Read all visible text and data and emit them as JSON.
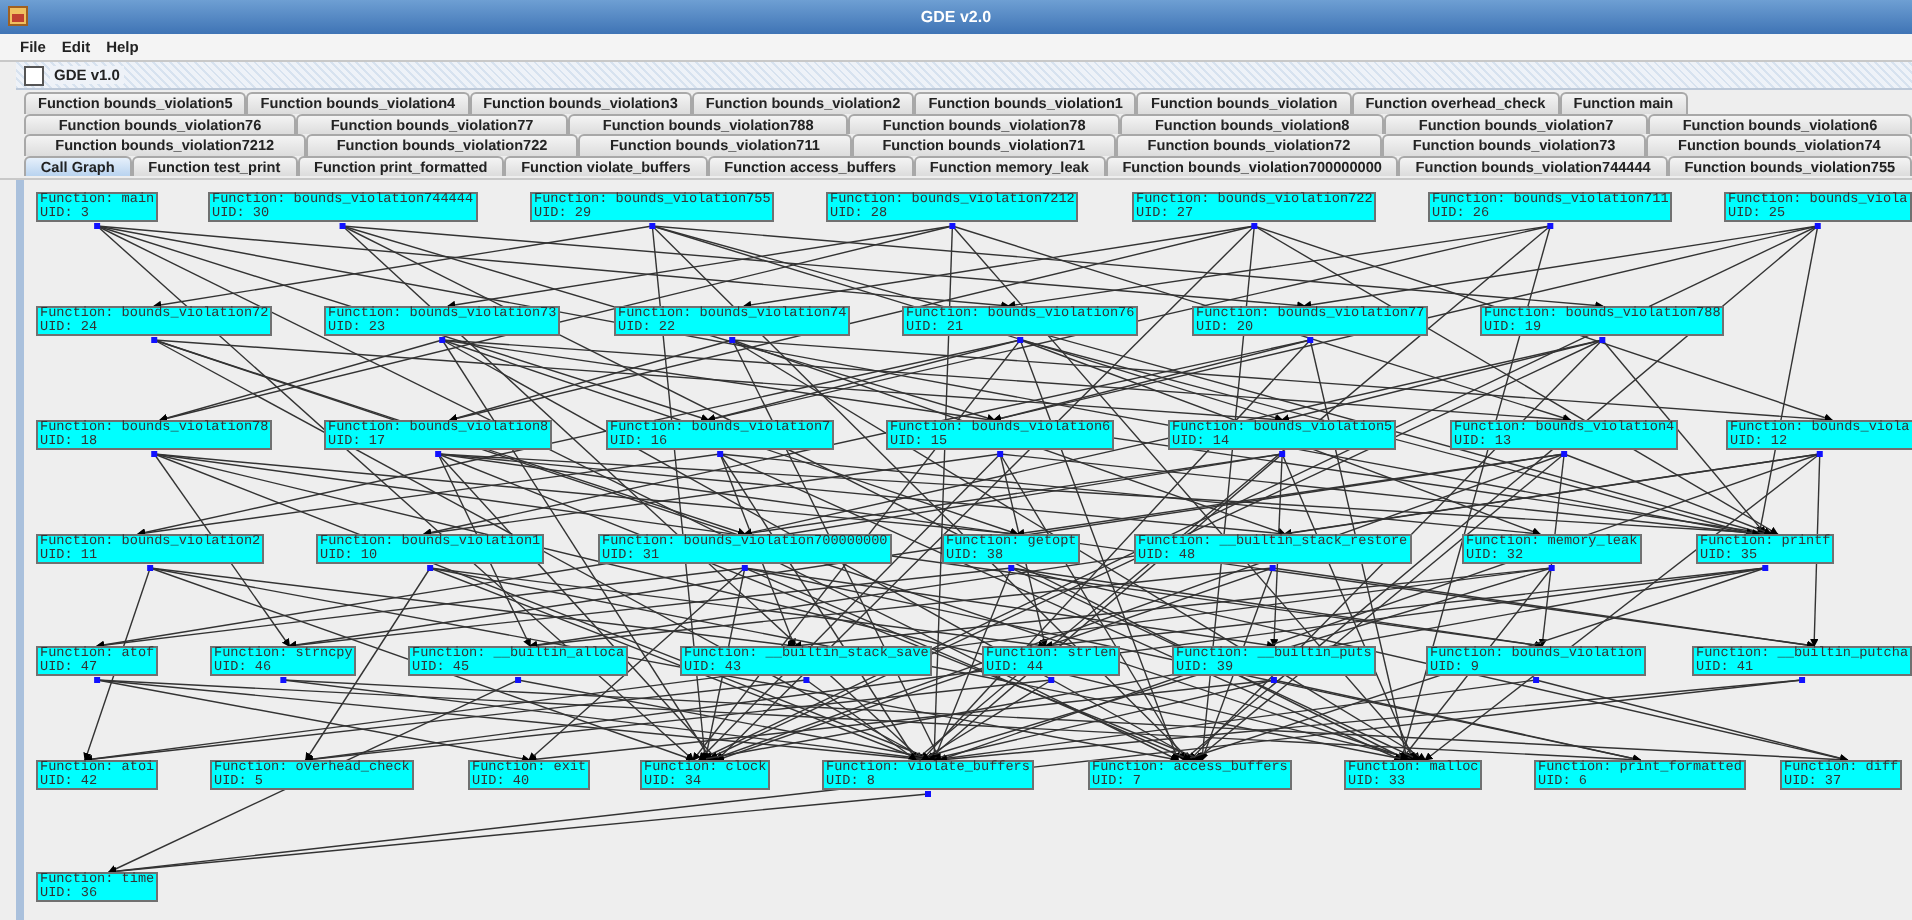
{
  "window": {
    "title": "GDE v2.0"
  },
  "menu": [
    "File",
    "Edit",
    "Help"
  ],
  "inner_frame": {
    "title": "GDE v1.0"
  },
  "tab_rows": [
    [
      {
        "label": "Function bounds_violation5",
        "selected": false
      },
      {
        "label": "Function bounds_violation4",
        "selected": false
      },
      {
        "label": "Function bounds_violation3",
        "selected": false
      },
      {
        "label": "Function bounds_violation2",
        "selected": false
      },
      {
        "label": "Function bounds_violation1",
        "selected": false
      },
      {
        "label": "Function bounds_violation",
        "selected": false
      },
      {
        "label": "Function overhead_check",
        "selected": false
      },
      {
        "label": "Function main",
        "selected": false
      }
    ],
    [
      {
        "label": "Function bounds_violation76",
        "selected": false
      },
      {
        "label": "Function bounds_violation77",
        "selected": false
      },
      {
        "label": "Function bounds_violation788",
        "selected": false
      },
      {
        "label": "Function bounds_violation78",
        "selected": false
      },
      {
        "label": "Function bounds_violation8",
        "selected": false
      },
      {
        "label": "Function bounds_violation7",
        "selected": false
      },
      {
        "label": "Function bounds_violation6",
        "selected": false
      }
    ],
    [
      {
        "label": "Function bounds_violation7212",
        "selected": false
      },
      {
        "label": "Function bounds_violation722",
        "selected": false
      },
      {
        "label": "Function bounds_violation711",
        "selected": false
      },
      {
        "label": "Function bounds_violation71",
        "selected": false
      },
      {
        "label": "Function bounds_violation72",
        "selected": false
      },
      {
        "label": "Function bounds_violation73",
        "selected": false
      },
      {
        "label": "Function bounds_violation74",
        "selected": false
      }
    ],
    [
      {
        "label": "Call Graph",
        "selected": true
      },
      {
        "label": "Function test_print",
        "selected": false
      },
      {
        "label": "Function print_formatted",
        "selected": false
      },
      {
        "label": "Function violate_buffers",
        "selected": false
      },
      {
        "label": "Function access_buffers",
        "selected": false
      },
      {
        "label": "Function memory_leak",
        "selected": false
      },
      {
        "label": "Function bounds_violation700000000",
        "selected": false
      },
      {
        "label": "Function bounds_violation744444",
        "selected": false
      },
      {
        "label": "Function bounds_violation755",
        "selected": false
      }
    ]
  ],
  "graph": {
    "node_rows": [
      [
        {
          "name": "Function: main",
          "uid": "UID: 3"
        },
        {
          "name": "Function: bounds_violation744444",
          "uid": "UID: 30"
        },
        {
          "name": "Function: bounds_violation755",
          "uid": "UID: 29"
        },
        {
          "name": "Function: bounds_violation7212",
          "uid": "UID: 28"
        },
        {
          "name": "Function: bounds_violation722",
          "uid": "UID: 27"
        },
        {
          "name": "Function: bounds_violation711",
          "uid": "UID: 26"
        },
        {
          "name": "Function: bounds_viola",
          "uid": "UID: 25"
        }
      ],
      [
        {
          "name": "Function: bounds_violation72",
          "uid": "UID: 24"
        },
        {
          "name": "Function: bounds_violation73",
          "uid": "UID: 23"
        },
        {
          "name": "Function: bounds_violation74",
          "uid": "UID: 22"
        },
        {
          "name": "Function: bounds_violation76",
          "uid": "UID: 21"
        },
        {
          "name": "Function: bounds_violation77",
          "uid": "UID: 20"
        },
        {
          "name": "Function: bounds_violation788",
          "uid": "UID: 19"
        }
      ],
      [
        {
          "name": "Function: bounds_violation78",
          "uid": "UID: 18"
        },
        {
          "name": "Function: bounds_violation8",
          "uid": "UID: 17"
        },
        {
          "name": "Function: bounds_violation7",
          "uid": "UID: 16"
        },
        {
          "name": "Function: bounds_violation6",
          "uid": "UID: 15"
        },
        {
          "name": "Function: bounds_violation5",
          "uid": "UID: 14"
        },
        {
          "name": "Function: bounds_violation4",
          "uid": "UID: 13"
        },
        {
          "name": "Function: bounds_viola",
          "uid": "UID: 12"
        }
      ],
      [
        {
          "name": "Function: bounds_violation2",
          "uid": "UID: 11"
        },
        {
          "name": "Function: bounds_violation1",
          "uid": "UID: 10"
        },
        {
          "name": "Function: bounds_violation700000000",
          "uid": "UID: 31"
        },
        {
          "name": "Function: getopt",
          "uid": "UID: 38"
        },
        {
          "name": "Function: __builtin_stack_restore",
          "uid": "UID: 48"
        },
        {
          "name": "Function: memory_leak",
          "uid": "UID: 32"
        },
        {
          "name": "Function: printf",
          "uid": "UID: 35"
        }
      ],
      [
        {
          "name": "Function: atof",
          "uid": "UID: 47"
        },
        {
          "name": "Function: strncpy",
          "uid": "UID: 46"
        },
        {
          "name": "Function: __builtin_alloca",
          "uid": "UID: 45"
        },
        {
          "name": "Function: __builtin_stack_save",
          "uid": "UID: 43"
        },
        {
          "name": "Function: strlen",
          "uid": "UID: 44"
        },
        {
          "name": "Function: __builtin_puts",
          "uid": "UID: 39"
        },
        {
          "name": "Function: bounds_violation",
          "uid": "UID: 9"
        },
        {
          "name": "Function: __builtin_putcha",
          "uid": "UID: 41"
        }
      ],
      [
        {
          "name": "Function: atoi",
          "uid": "UID: 42"
        },
        {
          "name": "Function: overhead_check",
          "uid": "UID: 5"
        },
        {
          "name": "Function: exit",
          "uid": "UID: 40"
        },
        {
          "name": "Function: clock",
          "uid": "UID: 34"
        },
        {
          "name": "Function: violate_buffers",
          "uid": "UID: 8"
        },
        {
          "name": "Function: access_buffers",
          "uid": "UID: 7"
        },
        {
          "name": "Function: malloc",
          "uid": "UID: 33"
        },
        {
          "name": "Function: print_formatted",
          "uid": "UID: 6"
        },
        {
          "name": "Function: diff",
          "uid": "UID: 37"
        }
      ],
      [
        {
          "name": "Function: time",
          "uid": "UID: 36"
        }
      ]
    ]
  }
}
